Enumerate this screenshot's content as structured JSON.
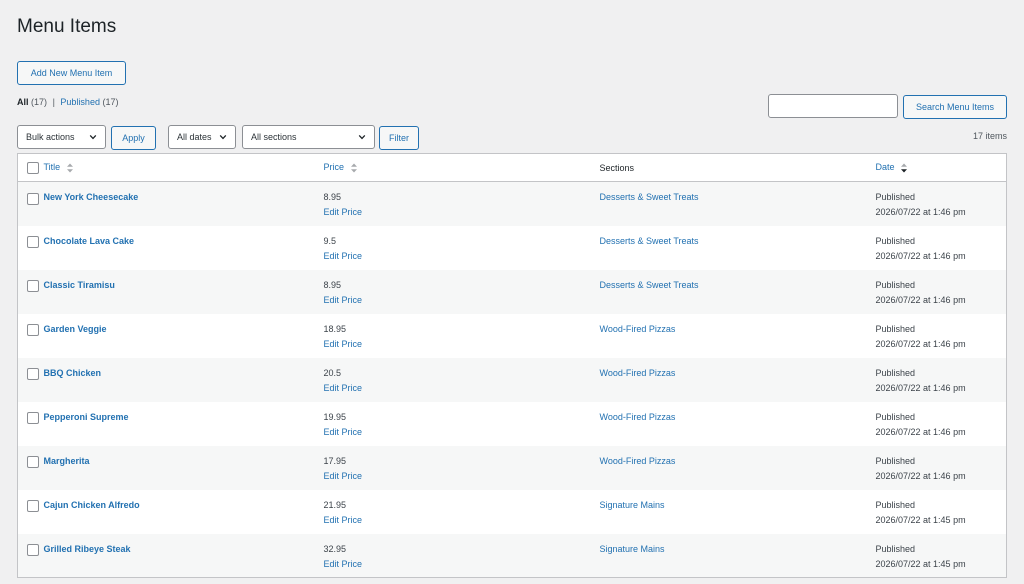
{
  "page_title": "Menu Items",
  "add_new_label": "Add New Menu Item",
  "views": {
    "all_label": "All",
    "all_count": "(17)",
    "separator": "|",
    "published_label": "Published",
    "published_count": "(17)"
  },
  "search": {
    "button_label": "Search Menu Items",
    "value": ""
  },
  "filters": {
    "bulk_actions": "Bulk actions",
    "apply_label": "Apply",
    "dates": "All dates",
    "sections": "All sections",
    "filter_label": "Filter"
  },
  "items_count": "17 items",
  "columns": {
    "title": "Title",
    "price": "Price",
    "sections": "Sections",
    "date": "Date"
  },
  "rows": [
    {
      "title": "New York Cheesecake",
      "price": "8.95",
      "edit": "Edit Price",
      "section": "Desserts & Sweet Treats",
      "status": "Published",
      "date": "2026/07/22 at 1:46 pm"
    },
    {
      "title": "Chocolate Lava Cake",
      "price": "9.5",
      "edit": "Edit Price",
      "section": "Desserts & Sweet Treats",
      "status": "Published",
      "date": "2026/07/22 at 1:46 pm"
    },
    {
      "title": "Classic Tiramisu",
      "price": "8.95",
      "edit": "Edit Price",
      "section": "Desserts & Sweet Treats",
      "status": "Published",
      "date": "2026/07/22 at 1:46 pm"
    },
    {
      "title": "Garden Veggie",
      "price": "18.95",
      "edit": "Edit Price",
      "section": "Wood-Fired Pizzas",
      "status": "Published",
      "date": "2026/07/22 at 1:46 pm"
    },
    {
      "title": "BBQ Chicken",
      "price": "20.5",
      "edit": "Edit Price",
      "section": "Wood-Fired Pizzas",
      "status": "Published",
      "date": "2026/07/22 at 1:46 pm"
    },
    {
      "title": "Pepperoni Supreme",
      "price": "19.95",
      "edit": "Edit Price",
      "section": "Wood-Fired Pizzas",
      "status": "Published",
      "date": "2026/07/22 at 1:46 pm"
    },
    {
      "title": "Margherita",
      "price": "17.95",
      "edit": "Edit Price",
      "section": "Wood-Fired Pizzas",
      "status": "Published",
      "date": "2026/07/22 at 1:46 pm"
    },
    {
      "title": "Cajun Chicken Alfredo",
      "price": "21.95",
      "edit": "Edit Price",
      "section": "Signature Mains",
      "status": "Published",
      "date": "2026/07/22 at 1:45 pm"
    },
    {
      "title": "Grilled Ribeye Steak",
      "price": "32.95",
      "edit": "Edit Price",
      "section": "Signature Mains",
      "status": "Published",
      "date": "2026/07/22 at 1:45 pm"
    }
  ],
  "colors": {
    "link": "#2271b1",
    "background": "#f0f0f1",
    "row_alt": "#f6f7f7",
    "border": "#c3c4c7"
  }
}
